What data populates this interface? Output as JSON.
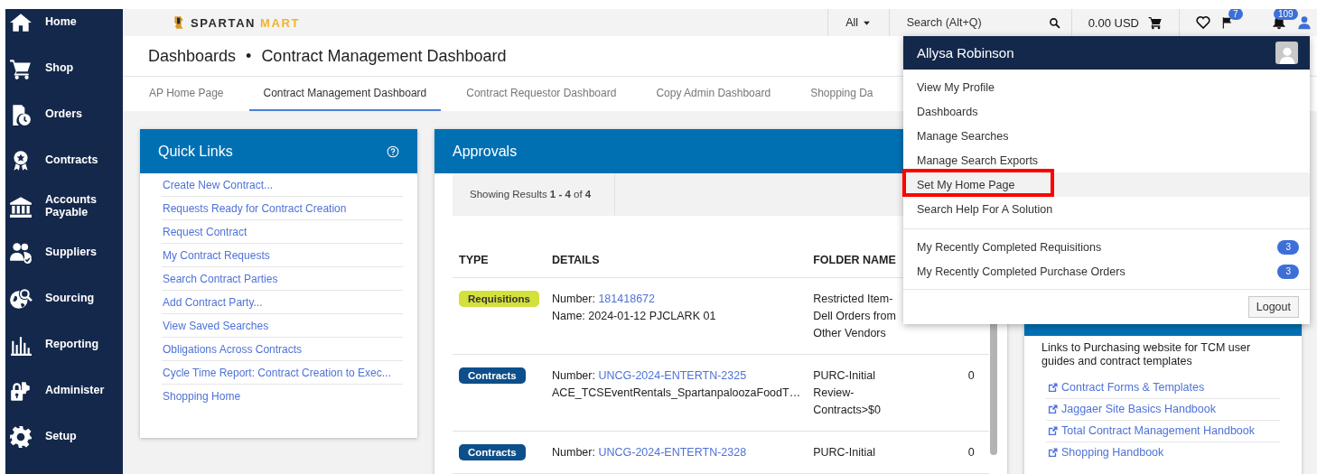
{
  "sidebar": {
    "items": [
      {
        "label": "Home"
      },
      {
        "label": "Shop"
      },
      {
        "label": "Orders"
      },
      {
        "label": "Contracts"
      },
      {
        "label": "Accounts Payable"
      },
      {
        "label": "Suppliers"
      },
      {
        "label": "Sourcing"
      },
      {
        "label": "Reporting"
      },
      {
        "label": "Administer"
      },
      {
        "label": "Setup"
      }
    ]
  },
  "top_bar": {
    "logo": {
      "part_1": "SPARTAN",
      "part_2": "MART"
    },
    "scope": "All",
    "search": {
      "placeholder": "Search (Alt+Q)"
    },
    "cart_total": "0.00 USD",
    "flag_badge": "7",
    "bell_badge": "109"
  },
  "page": {
    "breadcrumb": "Dashboards",
    "separator": "•",
    "title": "Contract Management Dashboard"
  },
  "tabs": [
    {
      "label": "AP Home Page",
      "selected": false
    },
    {
      "label": "Contract Management Dashboard",
      "selected": true
    },
    {
      "label": "Contract Requestor Dashboard",
      "selected": false
    },
    {
      "label": "Copy Admin Dashboard",
      "selected": false
    },
    {
      "label": "Shopping Da",
      "selected": false
    }
  ],
  "quick_links": {
    "title": "Quick Links",
    "links": [
      "Create New Contract...",
      "Requests Ready for Contract Creation",
      "Request Contract",
      "My Contract Requests",
      "Search Contract Parties",
      "Add Contract Party...",
      "View Saved Searches",
      "Obligations Across Contracts",
      "Cycle Time Report: Contract Creation to Exec...",
      "Shopping Home"
    ]
  },
  "approvals": {
    "title": "Approvals",
    "results": "Showing Results **1 - 4** of **4**",
    "columns": [
      "TYPE",
      "DETAILS",
      "FOLDER NAME"
    ],
    "rows": [
      {
        "type": {
          "label": "Requisitions",
          "color": "#d4e03c"
        },
        "number_label": "Number:",
        "number": "181418672",
        "name": "Name: 2024-01-12 PJCLARK 01",
        "folder": "Restricted Item-Dell Orders from Other Vendors"
      },
      {
        "type": {
          "label": "Contracts",
          "color": "#0d4f8b"
        },
        "number_label": "Number:",
        "number": "UNCG-2024-ENTERTN-2325",
        "name": "ACE_TCSEventRentals_SpartanpaloozaFoodT…",
        "folder": "PURC-Initial Review-Contracts>$0",
        "column_4": "0"
      },
      {
        "type": {
          "label": "Contracts",
          "color": "#0d4f8b"
        },
        "number_label": "Number:",
        "number": "UNCG-2024-ENTERTN-2328",
        "folder": "PURC-Initial",
        "column_4": "0"
      }
    ]
  },
  "resources": {
    "description": "Links to Purchasing website for TCM user guides and contract templates",
    "links": [
      "Contract Forms & Templates",
      "Jaggaer Site Basics Handbook",
      "Total Contract Management Handbook",
      "Shopping Handbook"
    ]
  },
  "user_menu": {
    "name": "Allysa Robinson",
    "items": [
      {
        "label": "View My Profile",
        "highlighted": false
      },
      {
        "label": "Dashboards",
        "highlighted": false
      },
      {
        "label": "Manage Searches",
        "highlighted": false
      },
      {
        "label": "Manage Search Exports",
        "highlighted": false
      },
      {
        "label": "Set My Home Page",
        "highlighted": true
      },
      {
        "label": "Search Help For A Solution",
        "highlighted": false
      }
    ],
    "counters": [
      {
        "label": "My Recently Completed Requisitions",
        "count": "3"
      },
      {
        "label": "My Recently Completed Purchase Orders",
        "count": "3"
      }
    ],
    "logout": "Logout"
  }
}
